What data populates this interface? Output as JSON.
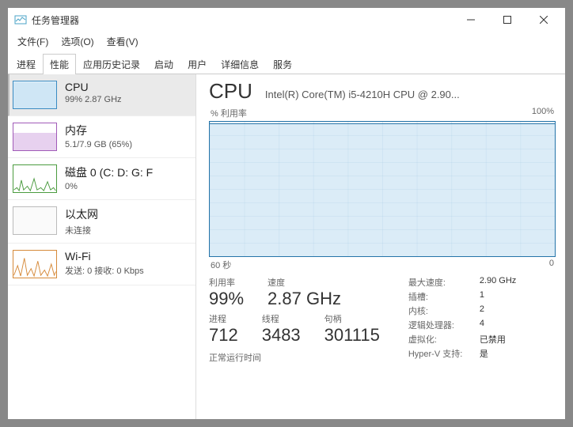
{
  "window": {
    "title": "任务管理器"
  },
  "menu": {
    "file": "文件(F)",
    "options": "选项(O)",
    "view": "查看(V)"
  },
  "tabs": [
    {
      "label": "进程"
    },
    {
      "label": "性能"
    },
    {
      "label": "应用历史记录"
    },
    {
      "label": "启动"
    },
    {
      "label": "用户"
    },
    {
      "label": "详细信息"
    },
    {
      "label": "服务"
    }
  ],
  "sidebar": {
    "cpu": {
      "title": "CPU",
      "sub": "99%  2.87 GHz"
    },
    "mem": {
      "title": "内存",
      "sub": "5.1/7.9 GB (65%)"
    },
    "disk": {
      "title": "磁盘 0 (C: D: G: F",
      "sub": "0%"
    },
    "eth": {
      "title": "以太网",
      "sub": "未连接"
    },
    "wifi": {
      "title": "Wi-Fi",
      "sub": "发送: 0 接收: 0 Kbps"
    }
  },
  "main": {
    "title": "CPU",
    "model": "Intel(R) Core(TM) i5-4210H CPU @ 2.90...",
    "utilization_label": "% 利用率",
    "utilization_max": "100%",
    "xaxis_left": "60 秒",
    "xaxis_right": "0",
    "stats": {
      "util_label": "利用率",
      "util_value": "99%",
      "speed_label": "速度",
      "speed_value": "2.87 GHz",
      "proc_label": "进程",
      "proc_value": "712",
      "threads_label": "线程",
      "threads_value": "3483",
      "handles_label": "句柄",
      "handles_value": "301115"
    },
    "info": {
      "max_speed_k": "最大速度:",
      "max_speed_v": "2.90 GHz",
      "sockets_k": "插槽:",
      "sockets_v": "1",
      "cores_k": "内核:",
      "cores_v": "2",
      "logical_k": "逻辑处理器:",
      "logical_v": "4",
      "virt_k": "虚拟化:",
      "virt_v": "已禁用",
      "hyperv_k": "Hyper-V 支持:",
      "hyperv_v": "是"
    },
    "uptime_label": "正常运行时间"
  },
  "chart_data": {
    "type": "line",
    "title": "% 利用率",
    "ylabel": "% 利用率",
    "ylim": [
      0,
      100
    ],
    "xlabel": "秒",
    "xlim": [
      60,
      0
    ],
    "x": [
      60,
      55,
      50,
      45,
      40,
      35,
      30,
      25,
      20,
      15,
      10,
      5,
      0
    ],
    "values": [
      99,
      99,
      99,
      99,
      99,
      99,
      99,
      99,
      99,
      99,
      99,
      99,
      99
    ]
  }
}
